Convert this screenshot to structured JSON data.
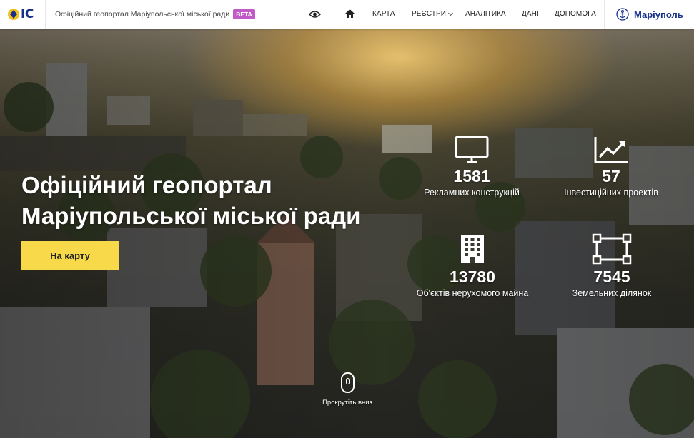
{
  "header": {
    "logo_text": "IC",
    "site_title": "Офіційний геопортал Маріупольської міської ради",
    "beta_label": "BETA",
    "nav": {
      "karta": "КАРТА",
      "reiestry": "РЕЄСТРИ",
      "analityka": "АНАЛІТИКА",
      "dani": "ДАНІ",
      "dopomoha": "ДОПОМОГА"
    },
    "city_name": "Маріуполь"
  },
  "hero": {
    "title_line1": "Офіційний геопортал",
    "title_line2": "Маріупольської міської ради",
    "cta_label": "На карту",
    "scroll_label": "Прокрутіть вниз"
  },
  "stats": {
    "ads": {
      "number": "1581",
      "label": "Рекламних конструкцій",
      "icon": "monitor-icon"
    },
    "investment": {
      "number": "57",
      "label": "Інвестиційних проектів",
      "icon": "chart-trend-icon"
    },
    "realty": {
      "number": "13780",
      "label": "Об'єктів нерухомого майна",
      "icon": "building-icon"
    },
    "land": {
      "number": "7545",
      "label": "Земельних ділянок",
      "icon": "land-plot-icon"
    }
  },
  "colors": {
    "brand_blue": "#16308c",
    "beta_purple": "#c159c7",
    "cta_yellow": "#f7d94a"
  }
}
